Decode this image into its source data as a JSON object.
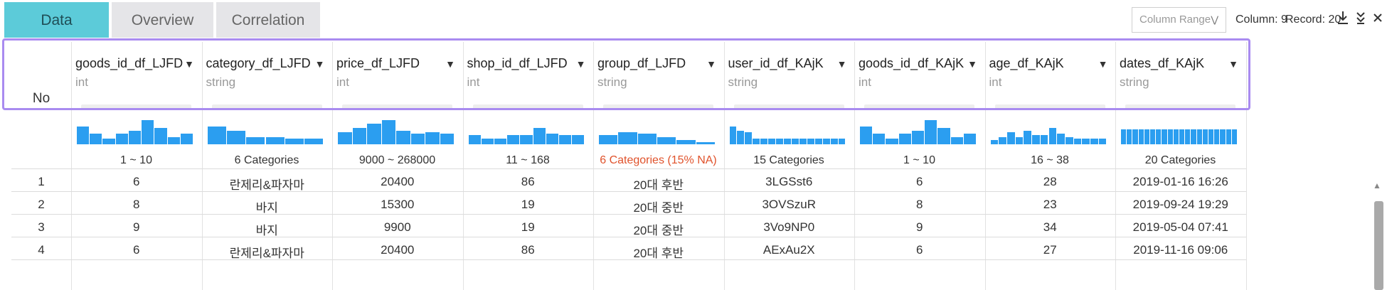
{
  "tabs": [
    {
      "label": "Data",
      "active": true
    },
    {
      "label": "Overview",
      "active": false
    },
    {
      "label": "Correlation",
      "active": false
    }
  ],
  "toolbar": {
    "column_range_placeholder": "Column Range",
    "column_count": "Column: 9",
    "record_count": "Record: 20",
    "icons": [
      "download-icon",
      "expand-all-icon",
      "close-icon"
    ]
  },
  "table": {
    "no_header": "No",
    "columns": [
      {
        "name": "goods_id_df_LJFD",
        "type": "int",
        "summary": "1 ~ 10",
        "summary_warn": false,
        "histogram": [
          0.6,
          0.35,
          0.2,
          0.35,
          0.45,
          0.8,
          0.55,
          0.25,
          0.35
        ]
      },
      {
        "name": "category_df_LJFD",
        "type": "string",
        "summary": "6 Categories",
        "summary_warn": false,
        "histogram": [
          0.6,
          0.45,
          0.25,
          0.25,
          0.2,
          0.2
        ]
      },
      {
        "name": "price_df_LJFD",
        "type": "int",
        "summary": "9000 ~ 268000",
        "summary_warn": false,
        "histogram": [
          0.4,
          0.55,
          0.7,
          0.8,
          0.45,
          0.35,
          0.4,
          0.35
        ]
      },
      {
        "name": "shop_id_df_LJFD",
        "type": "int",
        "summary": "11 ~ 168",
        "summary_warn": false,
        "histogram": [
          0.3,
          0.2,
          0.2,
          0.3,
          0.3,
          0.55,
          0.35,
          0.3,
          0.3
        ]
      },
      {
        "name": "group_df_LJFD",
        "type": "string",
        "summary": "6 Categories (15% NA)",
        "summary_warn": true,
        "histogram": [
          0.3,
          0.4,
          0.35,
          0.25,
          0.15,
          0.08
        ]
      },
      {
        "name": "user_id_df_KAjK",
        "type": "string",
        "summary": "15 Categories",
        "summary_warn": false,
        "histogram": [
          0.6,
          0.45,
          0.4,
          0.2,
          0.2,
          0.2,
          0.2,
          0.2,
          0.2,
          0.2,
          0.2,
          0.2,
          0.2,
          0.2,
          0.2
        ]
      },
      {
        "name": "goods_id_df_KAjK",
        "type": "int",
        "summary": "1 ~ 10",
        "summary_warn": false,
        "histogram": [
          0.6,
          0.35,
          0.2,
          0.35,
          0.45,
          0.8,
          0.55,
          0.25,
          0.35
        ]
      },
      {
        "name": "age_df_KAjK",
        "type": "int",
        "summary": "16 ~ 38",
        "summary_warn": false,
        "histogram": [
          0.15,
          0.25,
          0.4,
          0.25,
          0.45,
          0.3,
          0.3,
          0.55,
          0.35,
          0.25,
          0.2,
          0.2,
          0.2,
          0.2
        ]
      },
      {
        "name": "dates_df_KAjK",
        "type": "string",
        "summary": "20 Categories",
        "summary_warn": false,
        "histogram": [
          0.5,
          0.5,
          0.5,
          0.5,
          0.5,
          0.5,
          0.5,
          0.5,
          0.5,
          0.5,
          0.5,
          0.5,
          0.5,
          0.5,
          0.5,
          0.5,
          0.5,
          0.5,
          0.5,
          0.5
        ]
      }
    ],
    "rows": [
      {
        "no": "1",
        "cells": [
          "6",
          "란제리&파자마",
          "20400",
          "86",
          "20대 후반",
          "3LGSst6",
          "6",
          "28",
          "2019-01-16 16:26"
        ]
      },
      {
        "no": "2",
        "cells": [
          "8",
          "바지",
          "15300",
          "19",
          "20대 중반",
          "3OVSzuR",
          "8",
          "23",
          "2019-09-24 19:29"
        ]
      },
      {
        "no": "3",
        "cells": [
          "9",
          "바지",
          "9900",
          "19",
          "20대 중반",
          "3Vo9NP0",
          "9",
          "34",
          "2019-05-04 07:41"
        ]
      },
      {
        "no": "4",
        "cells": [
          "6",
          "란제리&파자마",
          "20400",
          "86",
          "20대 후반",
          "AExAu2X",
          "6",
          "27",
          "2019-11-16 09:06"
        ]
      }
    ]
  }
}
